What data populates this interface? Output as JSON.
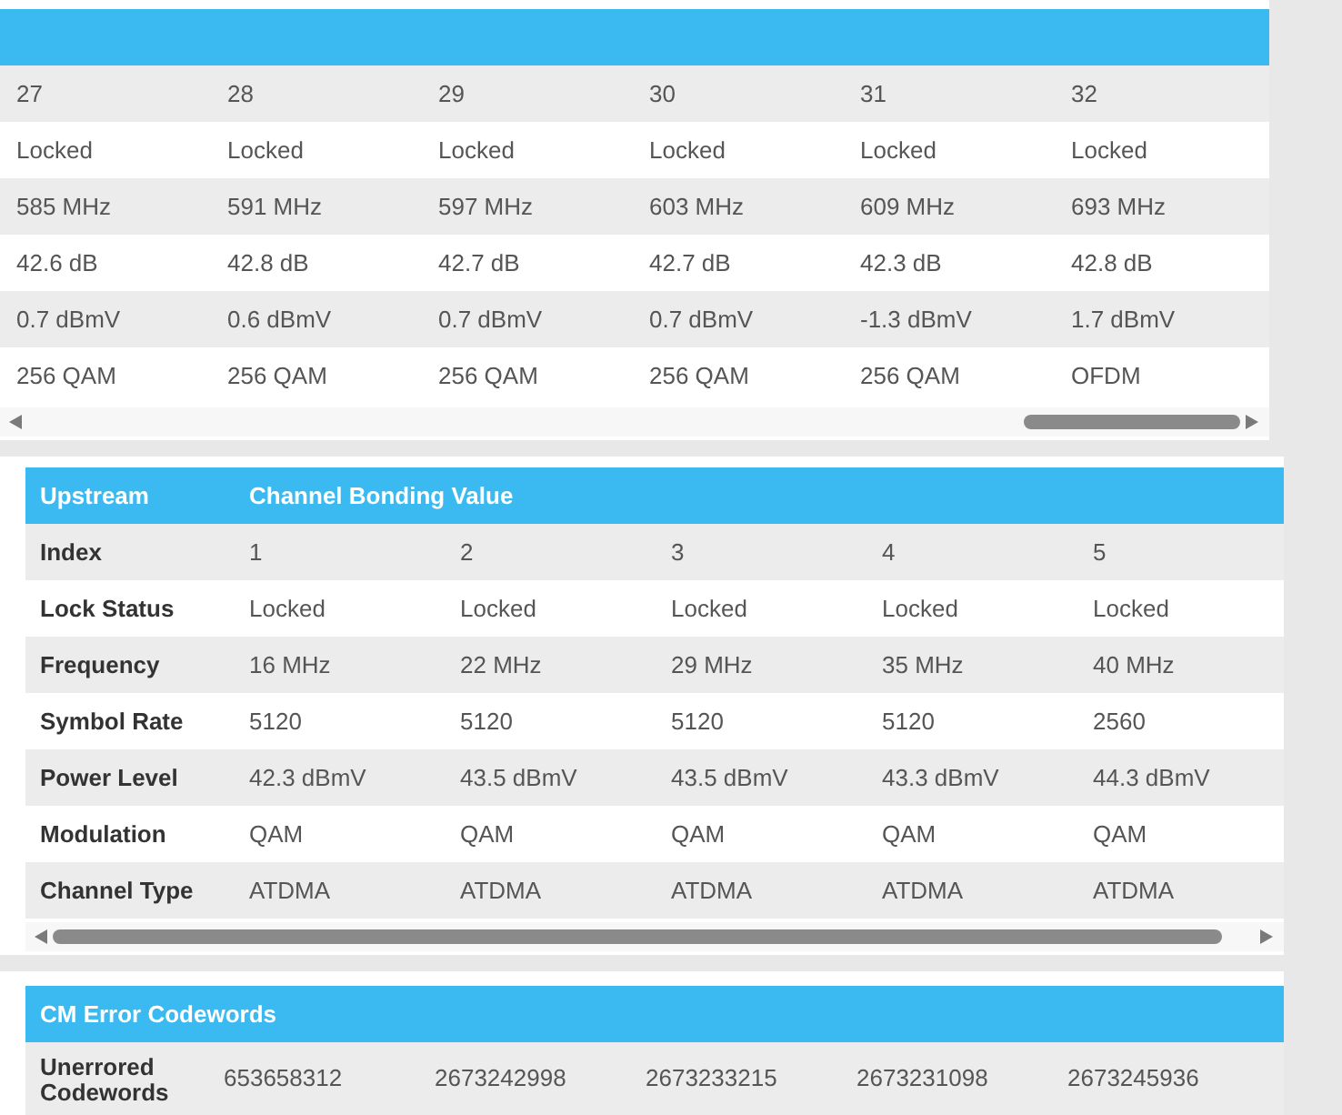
{
  "downstream": {
    "rows": [
      [
        "27",
        "28",
        "29",
        "30",
        "31",
        "32"
      ],
      [
        "Locked",
        "Locked",
        "Locked",
        "Locked",
        "Locked",
        "Locked"
      ],
      [
        "585 MHz",
        "591 MHz",
        "597 MHz",
        "603 MHz",
        "609 MHz",
        "693 MHz"
      ],
      [
        "42.6 dB",
        "42.8 dB",
        "42.7 dB",
        "42.7 dB",
        "42.3 dB",
        "42.8 dB"
      ],
      [
        "0.7 dBmV",
        "0.6 dBmV",
        "0.7 dBmV",
        "0.7 dBmV",
        "-1.3 dBmV",
        "1.7 dBmV"
      ],
      [
        "256 QAM",
        "256 QAM",
        "256 QAM",
        "256 QAM",
        "256 QAM",
        "OFDM"
      ]
    ]
  },
  "upstream": {
    "header": [
      "Upstream",
      "Channel Bonding Value"
    ],
    "rows": [
      {
        "label": "Index",
        "values": [
          "1",
          "2",
          "3",
          "4",
          "5"
        ]
      },
      {
        "label": "Lock Status",
        "values": [
          "Locked",
          "Locked",
          "Locked",
          "Locked",
          "Locked"
        ]
      },
      {
        "label": "Frequency",
        "values": [
          "16 MHz",
          "22 MHz",
          "29 MHz",
          "35 MHz",
          "40 MHz"
        ]
      },
      {
        "label": "Symbol Rate",
        "values": [
          "5120",
          "5120",
          "5120",
          "5120",
          "2560"
        ]
      },
      {
        "label": "Power Level",
        "values": [
          "42.3 dBmV",
          "43.5 dBmV",
          "43.5 dBmV",
          "43.3 dBmV",
          "44.3 dBmV"
        ]
      },
      {
        "label": "Modulation",
        "values": [
          "QAM",
          "QAM",
          "QAM",
          "QAM",
          "QAM"
        ]
      },
      {
        "label": "Channel Type",
        "values": [
          "ATDMA",
          "ATDMA",
          "ATDMA",
          "ATDMA",
          "ATDMA"
        ]
      }
    ]
  },
  "errors": {
    "title": "CM Error Codewords",
    "rows": [
      {
        "label": "Unerrored Codewords",
        "values": [
          "653658312",
          "2673242998",
          "2673233215",
          "2673231098",
          "2673245936"
        ]
      }
    ]
  }
}
